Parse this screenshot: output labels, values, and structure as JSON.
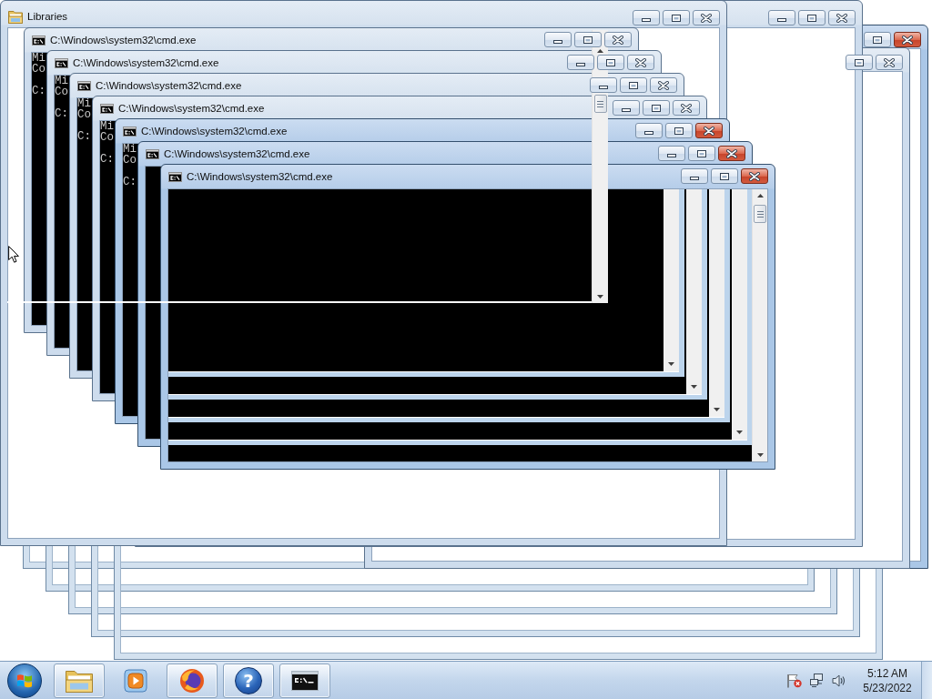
{
  "desktop": {
    "windows": [
      {
        "kind": "trail",
        "active": true
      },
      {
        "kind": "trail",
        "active": false
      },
      {
        "kind": "explorer",
        "active": false
      },
      {
        "kind": "explorer",
        "title": "Libraries",
        "active": false
      },
      {
        "kind": "console",
        "title": "C:\\Windows\\system32\\cmd.exe",
        "active": false,
        "output": [
          [
            "Mi",
            "Co"
          ],
          [
            "C:"
          ]
        ]
      },
      {
        "kind": "console",
        "title": "C:\\Windows\\system32\\cmd.exe",
        "active": false,
        "output": [
          [
            "Mi",
            "Co"
          ],
          [
            "C:"
          ]
        ]
      },
      {
        "kind": "console",
        "title": "C:\\Windows\\system32\\cmd.exe",
        "active": false,
        "output": [
          [
            "Mi",
            "Co"
          ],
          [
            "C:"
          ]
        ]
      },
      {
        "kind": "console",
        "title": "C:\\Windows\\system32\\cmd.exe",
        "active": false,
        "output": [
          [
            "Mi",
            "Co"
          ],
          [
            "C:"
          ]
        ]
      },
      {
        "kind": "console",
        "title": "C:\\Windows\\system32\\cmd.exe",
        "active": true,
        "output": [
          [
            "Mi",
            "Co"
          ],
          [
            "C:"
          ]
        ]
      },
      {
        "kind": "console",
        "title": "C:\\Windows\\system32\\cmd.exe",
        "active": true
      },
      {
        "kind": "console",
        "title": "C:\\Windows\\system32\\cmd.exe",
        "active": true
      }
    ]
  },
  "taskbar": {
    "buttons": [
      {
        "kind": "explorer",
        "running": true
      },
      {
        "kind": "player",
        "running": false
      },
      {
        "kind": "browser",
        "running": true
      },
      {
        "kind": "help",
        "running": true,
        "glyph": "?"
      },
      {
        "kind": "console",
        "running": true
      }
    ],
    "clock": {
      "time": "5:12 AM",
      "date": "5/23/2022"
    }
  }
}
